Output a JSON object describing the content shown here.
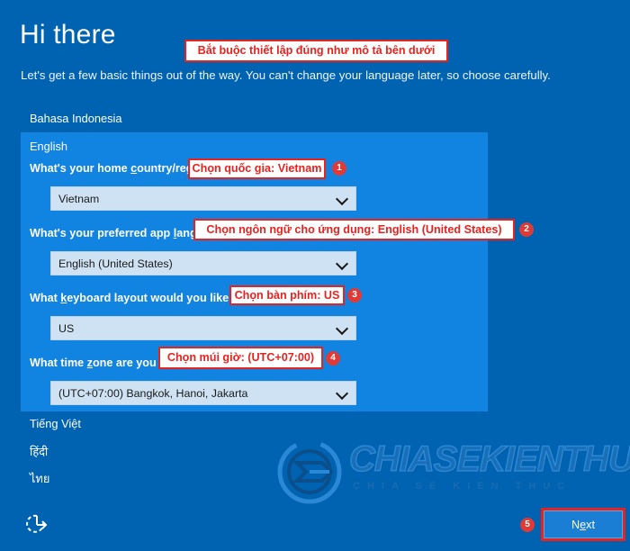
{
  "header": {
    "title": "Hi there",
    "subtitle": "Let's get a few basic things out of the way. You can't change your language later, so choose carefully."
  },
  "language_list": {
    "above": "Bahasa Indonesia",
    "selected": "English",
    "below": [
      "Tiếng Việt",
      "हिंदी",
      "ไทย"
    ]
  },
  "questions": [
    {
      "label_pre": "What's your home ",
      "label_underline": "c",
      "label_post": "ountry/region?",
      "value": "Vietnam"
    },
    {
      "label_pre": "What's your preferred app ",
      "label_underline": "l",
      "label_post": "anguage?",
      "value": "English (United States)"
    },
    {
      "label_pre": "What ",
      "label_underline": "k",
      "label_post": "eyboard layout would you like to use?",
      "value": "US"
    },
    {
      "label_pre": "What time ",
      "label_underline": "z",
      "label_post": "one are you in?",
      "value": "(UTC+07:00) Bangkok, Hanoi, Jakarta"
    }
  ],
  "annotations": {
    "banner": "Bắt buộc thiết lập đúng như mô tả bên dưới",
    "items": [
      {
        "text": "Chọn quốc gia: Vietnam",
        "badge": "1"
      },
      {
        "text": "Chọn ngôn ngữ cho ứng dụng: English (United States)",
        "badge": "2"
      },
      {
        "text": "Chọn bàn phím: US",
        "badge": "3"
      },
      {
        "text": "Chọn múi giờ: (UTC+07:00)",
        "badge": "4"
      },
      {
        "text": "",
        "badge": "5"
      }
    ]
  },
  "footer": {
    "next_label_pre": "N",
    "next_label_underline": "e",
    "next_label_post": "xt",
    "ease_of_access_icon": "ease-of-access-icon"
  },
  "watermark": {
    "text": "CHIASEKIENTHUC",
    "subtext": "CHIA SE KIEN THUC"
  },
  "colors": {
    "background": "#0063b1",
    "panel": "#1183e0",
    "combo": "#cfe2f3",
    "annotation": "#e8221f",
    "badge": "#e03a36",
    "next_button": "#1a7fd4"
  }
}
